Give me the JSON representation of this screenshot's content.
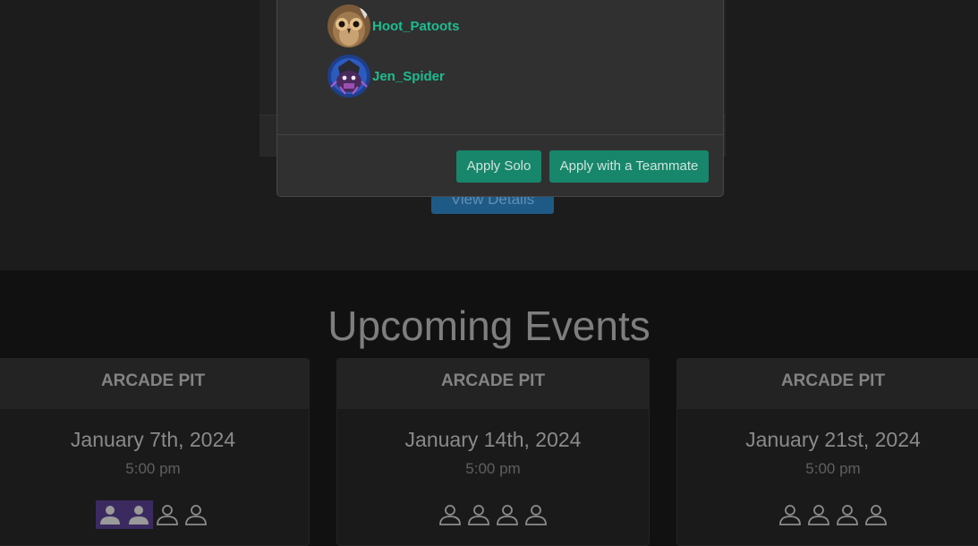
{
  "modal": {
    "members": [
      {
        "name": "Hoot_Patoots",
        "avatar": "owl-avatar"
      },
      {
        "name": "Jen_Spider",
        "avatar": "spider-avatar"
      }
    ],
    "apply_solo_label": "Apply Solo",
    "apply_team_label": "Apply with a Teammate"
  },
  "background": {
    "view_details_label": "View Details"
  },
  "section_title": "Upcoming Events",
  "events": [
    {
      "venue": "ARCADE PIT",
      "date": "January 7th, 2024",
      "time": "5:00 pm",
      "slots_filled": 2,
      "slots_total": 4
    },
    {
      "venue": "ARCADE PIT",
      "date": "January 14th, 2024",
      "time": "5:00 pm",
      "slots_filled": 0,
      "slots_total": 4
    },
    {
      "venue": "ARCADE PIT",
      "date": "January 21st, 2024",
      "time": "5:00 pm",
      "slots_filled": 0,
      "slots_total": 4
    }
  ],
  "colors": {
    "accent_green": "#17866b",
    "name_green": "#1ebc8f",
    "filled_slot": "#3a2a60"
  }
}
